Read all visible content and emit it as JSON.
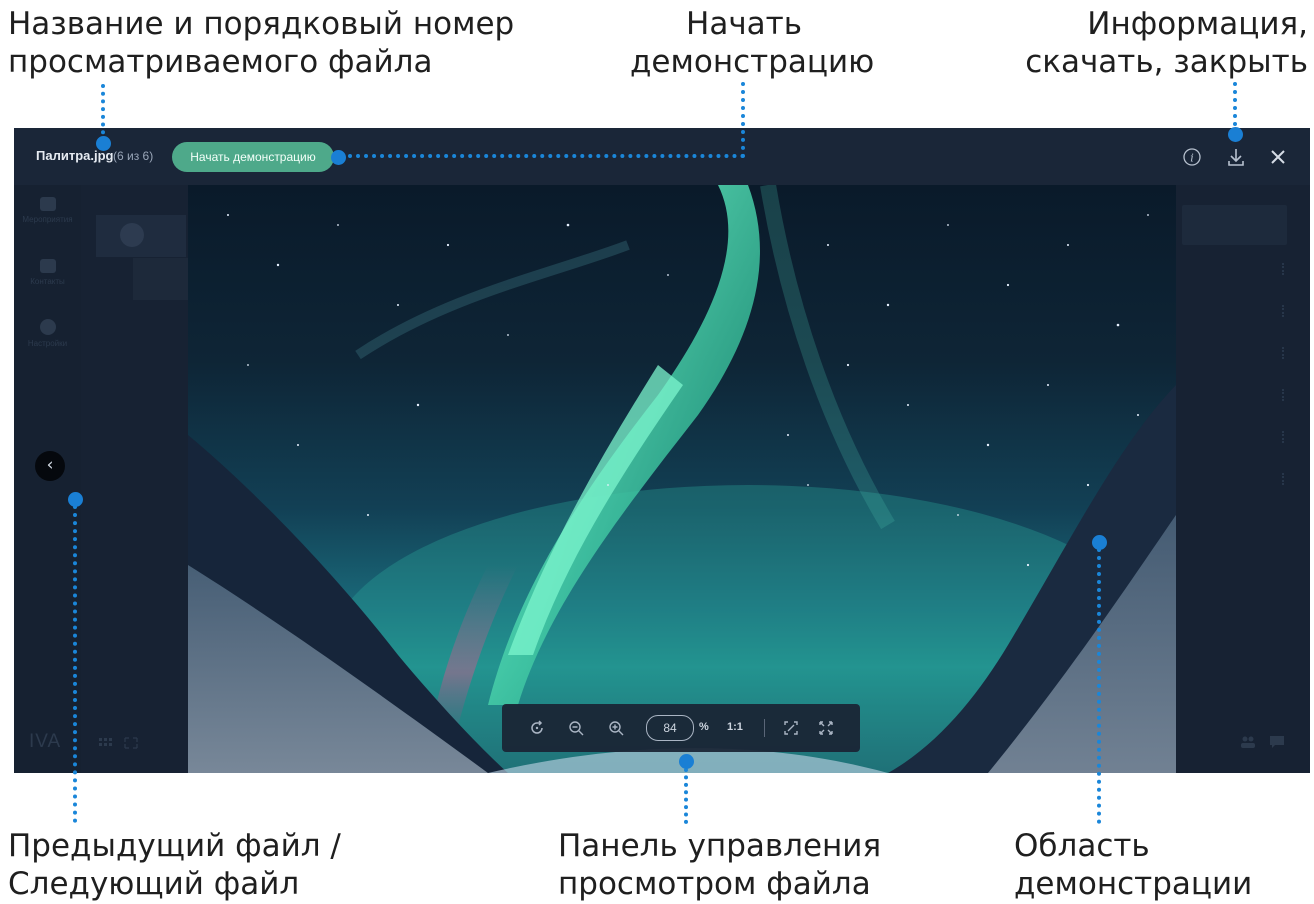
{
  "callouts": {
    "file_name": {
      "line1": "Название и порядковый номер",
      "line2": "просматриваемого файла"
    },
    "start_demo": {
      "line1": "Начать",
      "line2": "демонстрацию"
    },
    "info_download_close": {
      "line1": "Информация,",
      "line2": "скачать, закрыть"
    },
    "prev_next": {
      "line1": "Предыдущий файл /",
      "line2": "Следующий файл"
    },
    "control_panel": {
      "line1": "Панель управления",
      "line2": "просмотром файла"
    },
    "demo_area": {
      "line1": "Область",
      "line2": "демонстрации"
    }
  },
  "viewer": {
    "file_name": "Палитра.jpg",
    "file_counter": "(6 из 6)",
    "start_demo_label": "Начать демонстрацию",
    "info_icon": "info-icon",
    "download_icon": "download-icon",
    "close_icon": "close-icon",
    "prev_icon": "chevron-left-icon",
    "prev_glyph": "‹"
  },
  "controls": {
    "zoom_value": "84",
    "zoom_unit": "%",
    "actual_size_label": "1:1"
  },
  "background_app": {
    "sidebar": [
      "Мероприятия",
      "Контакты",
      "Настройки"
    ],
    "logo": "IVA"
  },
  "colors": {
    "accent_dot": "#1a7fd4",
    "start_demo_bg": "#4ea98a",
    "topbar_bg": "#1a2638"
  }
}
